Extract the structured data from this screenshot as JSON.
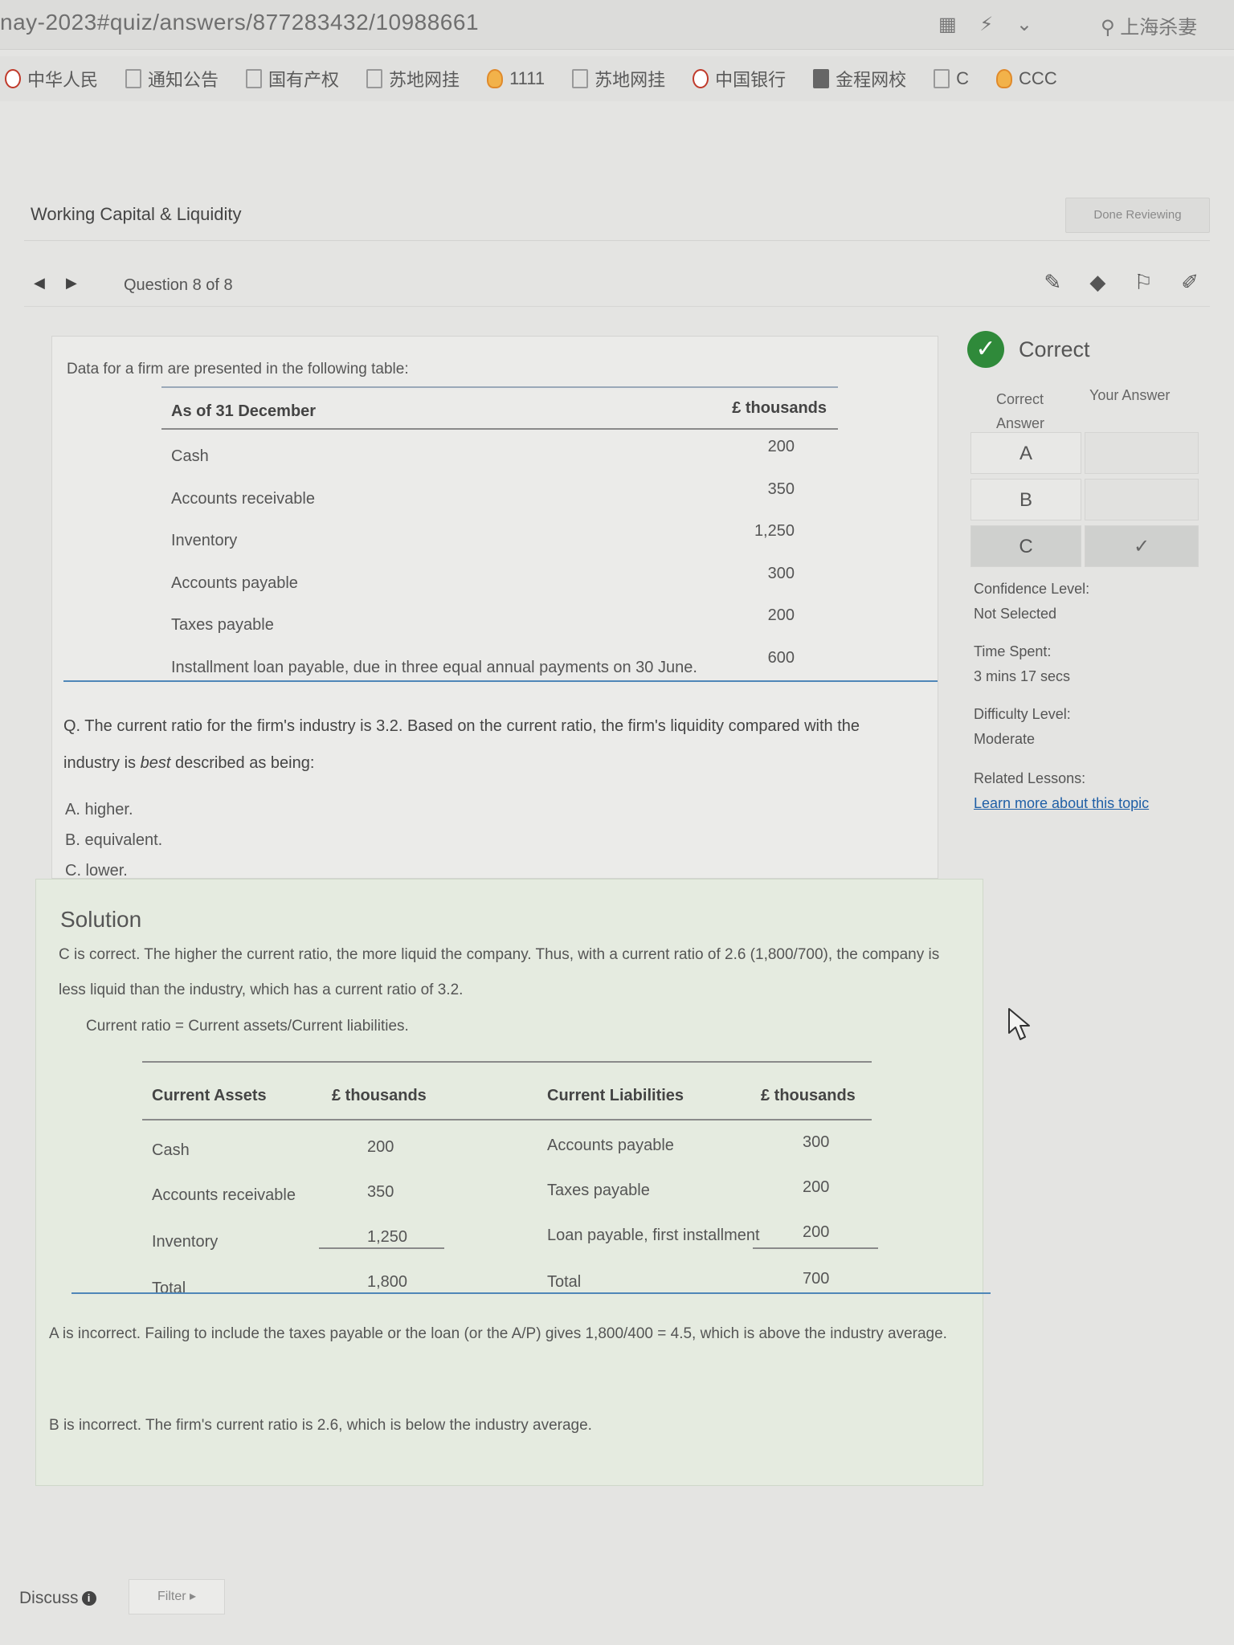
{
  "browser": {
    "url": "nay-2023#quiz/answers/877283432/10988661",
    "search_text": "上海杀妻",
    "bookmarks": [
      "中华人民",
      "通知公告",
      "国有产权",
      "苏地网挂",
      "1111",
      "苏地网挂",
      "中国银行",
      "金程网校",
      "C",
      "CCC"
    ]
  },
  "header": {
    "section_title": "Working Capital & Liquidity",
    "done_label": "Done Reviewing"
  },
  "nav": {
    "question_counter": "Question 8 of 8"
  },
  "question": {
    "intro": "Data for a firm are presented in the following table:",
    "table": {
      "col1": "As of 31 December",
      "col2": "£ thousands",
      "rows": [
        {
          "label": "Cash",
          "value": "200"
        },
        {
          "label": "Accounts receivable",
          "value": "350"
        },
        {
          "label": "Inventory",
          "value": "1,250"
        },
        {
          "label": "Accounts payable",
          "value": "300"
        },
        {
          "label": "Taxes payable",
          "value": "200"
        },
        {
          "label": "Installment loan payable, due in three equal annual payments on 30 June.",
          "value": "600"
        }
      ]
    },
    "text_before": "Q. The current ratio for the firm's industry is 3.2. Based on the current ratio, the firm's liquidity compared with the industry is ",
    "text_emph": "best",
    "text_after": " described as being:",
    "options": [
      "A. higher.",
      "B. equivalent.",
      "C. lower."
    ]
  },
  "solution": {
    "title": "Solution",
    "text": "C is correct. The higher the current ratio, the more liquid the company. Thus, with a current ratio of 2.6 (1,800/700), the company is less liquid than the industry, which has a current ratio of 3.2.",
    "formula": "Current ratio = Current assets/Current liabilities.",
    "table": {
      "h1": "Current Assets",
      "h2": "£ thousands",
      "h3": "Current Liabilities",
      "h4": "£ thousands",
      "assets": [
        {
          "label": "Cash",
          "value": "200"
        },
        {
          "label": "Accounts receivable",
          "value": "350"
        },
        {
          "label": "Inventory",
          "value": "1,250"
        },
        {
          "label": "Total",
          "value": "1,800"
        }
      ],
      "liabilities": [
        {
          "label": "Accounts payable",
          "value": "300"
        },
        {
          "label": "Taxes payable",
          "value": "200"
        },
        {
          "label": "Loan payable, first installment",
          "value": "200"
        },
        {
          "label": "Total",
          "value": "700"
        }
      ]
    },
    "a_incorrect": "A is incorrect. Failing to include the taxes payable or the loan (or the A/P) gives 1,800/400 = 4.5, which is above the industry average.",
    "b_incorrect": "B is incorrect. The firm's current ratio is 2.6, which is below the industry average."
  },
  "result": {
    "status": "Correct",
    "col_correct": "Correct Answer",
    "col_yours": "Your Answer",
    "answers": [
      {
        "letter": "A",
        "mark": ""
      },
      {
        "letter": "B",
        "mark": ""
      },
      {
        "letter": "C",
        "mark": "✓"
      }
    ],
    "confidence_label": "Confidence Level:",
    "confidence_value": "Not Selected",
    "time_label": "Time Spent:",
    "time_value": "3 mins 17 secs",
    "difficulty_label": "Difficulty Level:",
    "difficulty_value": "Moderate",
    "lessons_label": "Related Lessons:",
    "lessons_link": "Learn more about this topic"
  },
  "footer": {
    "discuss_label": "Discuss",
    "filter_label": "Filter ▸"
  }
}
